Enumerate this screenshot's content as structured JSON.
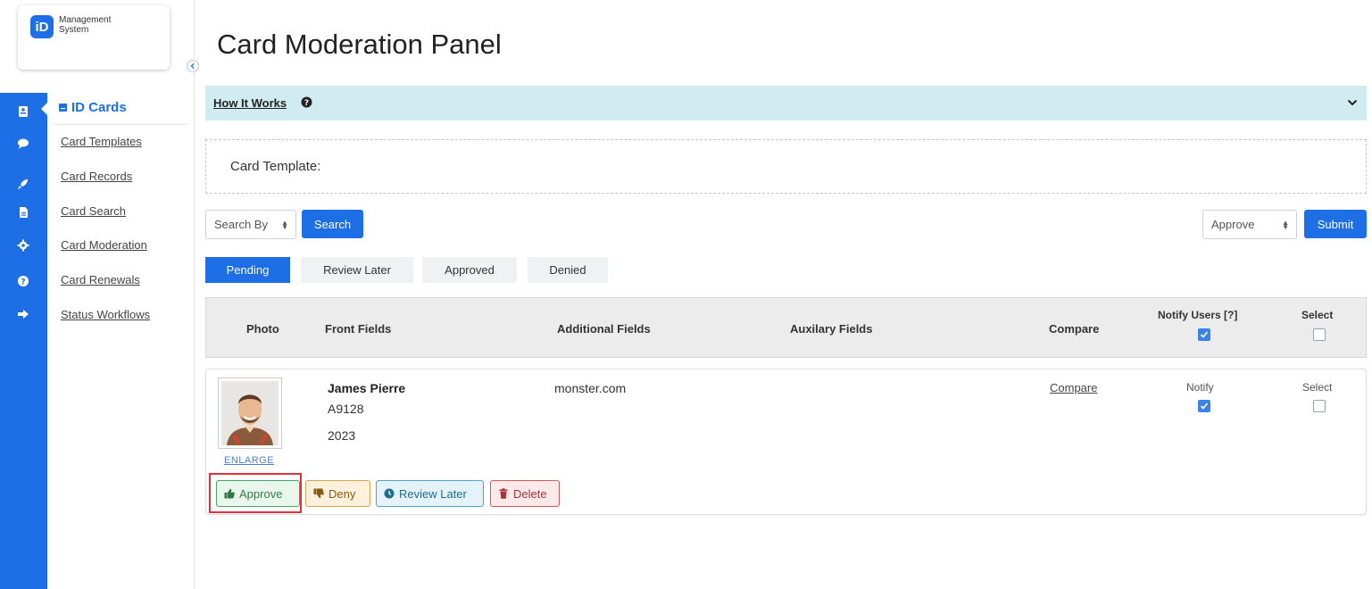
{
  "logo": {
    "badge": "iD",
    "line1": "Management",
    "line2": "System"
  },
  "rail_icons": [
    "id-card-icon",
    "chat-icon",
    "rocket-icon",
    "document-icon",
    "gear-icon",
    "help-icon",
    "logout-icon"
  ],
  "sidebar": {
    "heading": "ID Cards",
    "items": [
      {
        "label": "Card Templates"
      },
      {
        "label": "Card Records"
      },
      {
        "label": "Card Search"
      },
      {
        "label": "Card Moderation"
      },
      {
        "label": "Card Renewals"
      },
      {
        "label": "Status Workflows"
      }
    ]
  },
  "page": {
    "title": "Card Moderation Panel"
  },
  "how_it_works": {
    "label": "How It Works"
  },
  "template": {
    "label": "Card Template:"
  },
  "search": {
    "select_value": "Search By",
    "button": "Search"
  },
  "bulk": {
    "select_value": "Approve",
    "button": "Submit"
  },
  "tabs": [
    {
      "label": "Pending",
      "active": true
    },
    {
      "label": "Review Later",
      "active": false
    },
    {
      "label": "Approved",
      "active": false
    },
    {
      "label": "Denied",
      "active": false
    }
  ],
  "table": {
    "headers": {
      "photo": "Photo",
      "front": "Front Fields",
      "additional": "Additional Fields",
      "auxiliary": "Auxilary Fields",
      "compare": "Compare",
      "notify": "Notify Users [?]",
      "select": "Select"
    },
    "notify_all_checked": true,
    "select_all_checked": false
  },
  "record": {
    "enlarge": "ENLARGE",
    "name": "James Pierre",
    "id": "A9128",
    "year": "2023",
    "additional": "monster.com",
    "compare": "Compare",
    "notify_label": "Notify",
    "notify_checked": true,
    "select_label": "Select",
    "select_checked": false,
    "actions": {
      "approve": "Approve",
      "deny": "Deny",
      "review_later": "Review Later",
      "delete": "Delete"
    }
  },
  "colors": {
    "brand_blue": "#1e6ee6",
    "info_bar": "#d1ecf1",
    "highlight": "#e0303a"
  }
}
